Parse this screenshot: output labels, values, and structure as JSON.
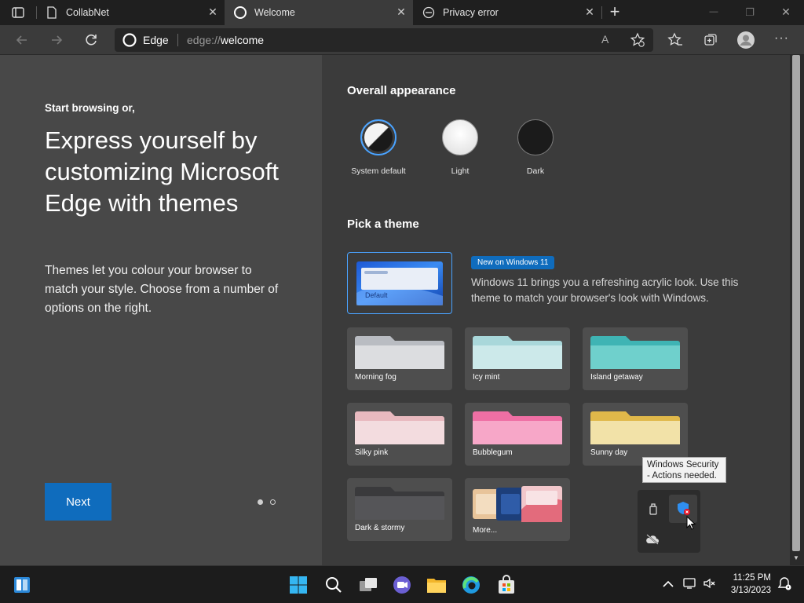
{
  "tabs": [
    {
      "title": "CollabNet",
      "close": "✕"
    },
    {
      "title": "Welcome",
      "close": "✕"
    },
    {
      "title": "Privacy error",
      "close": "✕"
    }
  ],
  "window_controls": {
    "new_tab": "+",
    "minimize": "—",
    "restore": "❐",
    "close": "✕"
  },
  "address": {
    "brand": "Edge",
    "url_prefix": "edge://",
    "url_path": "welcome"
  },
  "left_panel": {
    "kicker": "Start browsing or,",
    "headline": "Express yourself by customizing Microsoft Edge with themes",
    "description": "Themes let you colour your browser to match your style. Choose from a number of options on the right.",
    "next_label": "Next"
  },
  "appearance": {
    "heading": "Overall appearance",
    "options": [
      {
        "label": "System default"
      },
      {
        "label": "Light"
      },
      {
        "label": "Dark"
      }
    ]
  },
  "themes": {
    "heading": "Pick a theme",
    "featured": {
      "name": "Default",
      "badge": "New on Windows 11",
      "description": "Windows 11 brings you a refreshing acrylic look. Use this theme to match your browser's look with Windows."
    },
    "items": [
      {
        "label": "Morning fog",
        "color_top": "#b9bcc2",
        "color_body": "#dcdde0"
      },
      {
        "label": "Icy mint",
        "color_top": "#a9d7da",
        "color_body": "#cce9ea"
      },
      {
        "label": "Island getaway",
        "color_top": "#3fb4b4",
        "color_body": "#6fd0cc"
      },
      {
        "label": "Silky pink",
        "color_top": "#e8b9bf",
        "color_body": "#f3dcdf"
      },
      {
        "label": "Bubblegum",
        "color_top": "#ef6fa4",
        "color_body": "#f7a7c8"
      },
      {
        "label": "Sunny day",
        "color_top": "#e0b84a",
        "color_body": "#f2e2a8"
      },
      {
        "label": "Dark & stormy",
        "color_top": "#3a3a3c",
        "color_body": "#555558"
      },
      {
        "label": "More..."
      }
    ]
  },
  "tooltip": {
    "line1": "Windows Security",
    "line2": "- Actions needed."
  },
  "clock": {
    "time": "11:25 PM",
    "date": "3/13/2023"
  },
  "colors": {
    "accent": "#0f6cbd",
    "focus": "#4aa3ff"
  }
}
